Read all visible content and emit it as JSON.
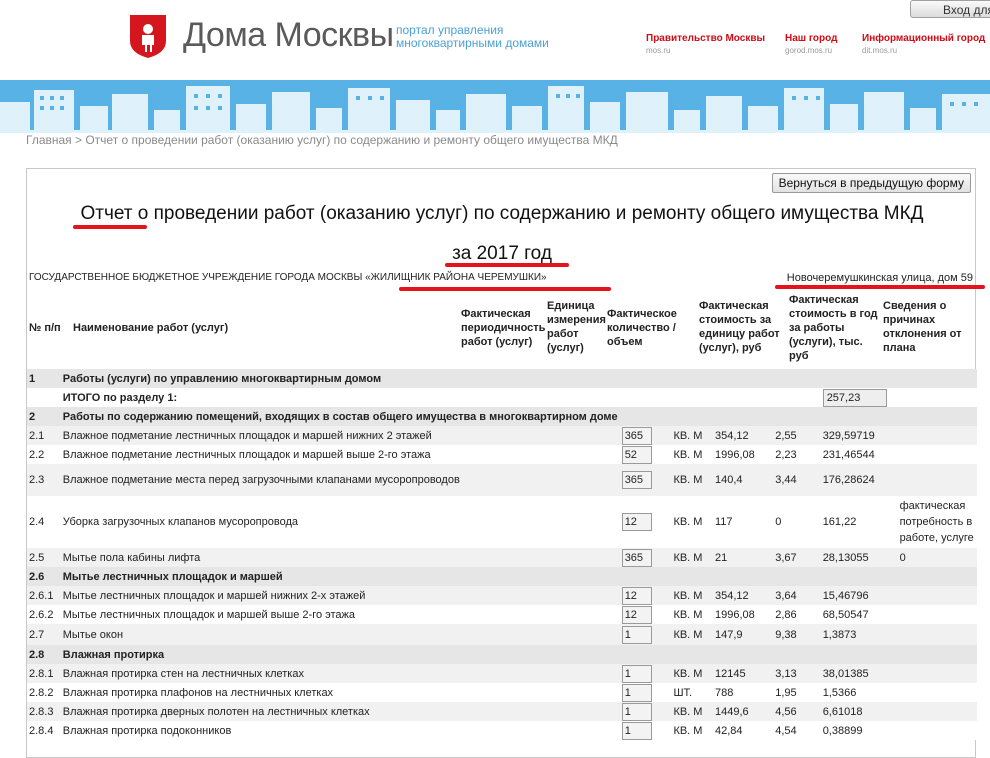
{
  "header": {
    "brand": "Дома Москвы",
    "tagline_line1": "портал управления",
    "tagline_line2": "многоквартирными домами",
    "login_label": "Вход для",
    "links": [
      {
        "label": "Правительство Москвы",
        "sub": "mos.ru"
      },
      {
        "label": "Наш город",
        "sub": "gorod.mos.ru"
      },
      {
        "label": "Информационный город",
        "sub": "dit.mos.ru"
      }
    ]
  },
  "breadcrumb": "Главная > Отчет о проведении работ (оказанию услуг) по содержанию и ремонту общего имущества МКД",
  "report": {
    "back_button": "Вернуться в предыдущую форму",
    "title": "Отчет о проведении работ (оказанию услуг) по содержанию и ремонту общего имущества МКД",
    "year": "за 2017 год",
    "organization": "ГОСУДАРСТВЕННОЕ БЮДЖЕТНОЕ УЧРЕЖДЕНИЕ ГОРОДА МОСКВЫ «ЖИЛИЩНИК РАЙОНА ЧЕРЕМУШКИ»",
    "address": "Новочеремушкинская улица, дом 59",
    "columns": [
      "№ п/п",
      "Наименование работ (услуг)",
      "Фактическая периодичность работ (услуг)",
      "Единица измерения работ (услуг)",
      "Фактическое количество / объем",
      "Фактическая стоимость за единицу работ (услуг), руб",
      "Фактическая стоимость в год за работы (услуги), тыс. руб",
      "Сведения о причинах отклонения от плана"
    ],
    "rows": [
      {
        "kind": "sec",
        "num": "1",
        "name": "Работы (услуги) по управлению многоквартирным домом",
        "per": "",
        "unit": "",
        "qty": "",
        "price": "",
        "cost": "",
        "note": ""
      },
      {
        "kind": "total",
        "num": "",
        "name": "ИТОГО по разделу 1:",
        "per": "",
        "unit": "",
        "qty": "",
        "price": "",
        "cost": "257,23",
        "note": ""
      },
      {
        "kind": "sec",
        "num": "2",
        "name": "Работы по содержанию помещений, входящих в состав общего имущества в многоквартирном доме",
        "per": "",
        "unit": "",
        "qty": "",
        "price": "",
        "cost": "",
        "note": ""
      },
      {
        "kind": "alt",
        "num": "2.1",
        "name": "Влажное подметание лестничных площадок и маршей нижних 2 этажей",
        "per": "365",
        "unit": "КВ. М",
        "qty": "354,12",
        "price": "2,55",
        "cost": "329,59719",
        "note": ""
      },
      {
        "kind": "plain",
        "num": "2.2",
        "name": "Влажное подметание лестничных площадок и маршей выше 2-го этажа",
        "per": "52",
        "unit": "КВ. М",
        "qty": "1996,08",
        "price": "2,23",
        "cost": "231,46544",
        "note": ""
      },
      {
        "kind": "alt",
        "num": "2.3",
        "name": "Влажное подметание места перед загрузочными клапанами мусоропроводов",
        "per": "365",
        "unit": "КВ. М",
        "qty": "140,4",
        "price": "3,44",
        "cost": "176,28624",
        "note": ""
      },
      {
        "kind": "plain",
        "num": "2.4",
        "name": "Уборка загрузочных клапанов мусоропровода",
        "per": "12",
        "unit": "КВ. М",
        "qty": "117",
        "price": "0",
        "cost": "161,22",
        "note": "фактическая потребность в работе, услуге"
      },
      {
        "kind": "alt",
        "num": "2.5",
        "name": "Мытье пола кабины лифта",
        "per": "365",
        "unit": "КВ. М",
        "qty": "21",
        "price": "3,67",
        "cost": "28,13055",
        "note": "0"
      },
      {
        "kind": "sec",
        "num": "2.6",
        "name": "Мытье лестничных площадок и маршей",
        "per": "",
        "unit": "",
        "qty": "",
        "price": "",
        "cost": "",
        "note": ""
      },
      {
        "kind": "alt",
        "num": "2.6.1",
        "name": "Мытье лестничных площадок и маршей нижних 2-х этажей",
        "per": "12",
        "unit": "КВ. М",
        "qty": "354,12",
        "price": "3,64",
        "cost": "15,46796",
        "note": ""
      },
      {
        "kind": "plain",
        "num": "2.6.2",
        "name": "Мытье лестничных площадок и маршей выше 2-го этажа",
        "per": "12",
        "unit": "КВ. М",
        "qty": "1996,08",
        "price": "2,86",
        "cost": "68,50547",
        "note": ""
      },
      {
        "kind": "alt",
        "num": "2.7",
        "name": "Мытье окон",
        "per": "1",
        "unit": "КВ. М",
        "qty": "147,9",
        "price": "9,38",
        "cost": "1,3873",
        "note": ""
      },
      {
        "kind": "sec",
        "num": "2.8",
        "name": "Влажная протирка",
        "per": "",
        "unit": "",
        "qty": "",
        "price": "",
        "cost": "",
        "note": ""
      },
      {
        "kind": "alt",
        "num": "2.8.1",
        "name": "Влажная протирка стен на лестничных клетках",
        "per": "1",
        "unit": "КВ. М",
        "qty": "12145",
        "price": "3,13",
        "cost": "38,01385",
        "note": ""
      },
      {
        "kind": "plain",
        "num": "2.8.2",
        "name": "Влажная протирка плафонов на лестничных клетках",
        "per": "1",
        "unit": "ШТ.",
        "qty": "788",
        "price": "1,95",
        "cost": "1,5366",
        "note": ""
      },
      {
        "kind": "alt",
        "num": "2.8.3",
        "name": "Влажная протирка дверных полотен на лестничных клетках",
        "per": "1",
        "unit": "КВ. М",
        "qty": "1449,6",
        "price": "4,56",
        "cost": "6,61018",
        "note": ""
      },
      {
        "kind": "plain",
        "num": "2.8.4",
        "name": "Влажная протирка подоконников",
        "per": "1",
        "unit": "КВ. М",
        "qty": "42,84",
        "price": "4,54",
        "cost": "0,38899",
        "note": ""
      }
    ]
  },
  "colors": {
    "accent": "#d10b14",
    "brand_blue": "#4aa8df",
    "highlight_line": "#e3141b"
  }
}
